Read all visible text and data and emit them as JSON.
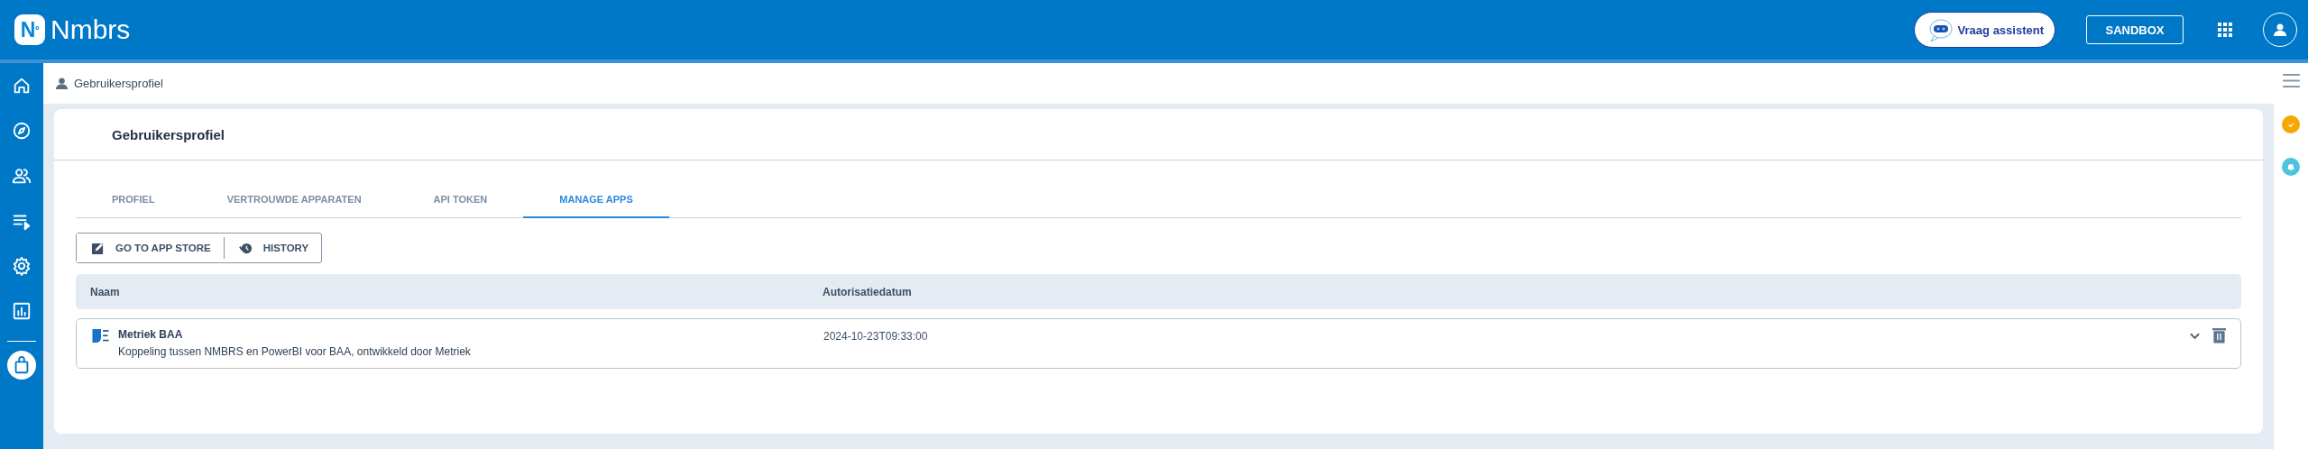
{
  "header": {
    "logo_mark": "N",
    "logo_sup": "º",
    "brand": "Nmbrs",
    "assistant": "Vraag assistent",
    "environment": "SANDBOX"
  },
  "sidebar": {
    "items": [
      {
        "kind": "home",
        "selected": false
      },
      {
        "kind": "compass",
        "selected": false
      },
      {
        "kind": "people",
        "selected": false
      },
      {
        "kind": "queue",
        "selected": false
      },
      {
        "kind": "settings",
        "selected": false
      },
      {
        "kind": "chart",
        "selected": false
      },
      {
        "kind": "bag",
        "selected": true
      }
    ]
  },
  "breadcrumb": "Gebruikersprofiel",
  "card": {
    "title": "Gebruikersprofiel",
    "tabs": [
      {
        "label": "PROFIEL",
        "selected": false
      },
      {
        "label": "VERTROUWDE APPARATEN",
        "selected": false
      },
      {
        "label": "API TOKEN",
        "selected": false
      },
      {
        "label": "MANAGE APPS",
        "selected": true
      }
    ],
    "actions": [
      {
        "kind": "store",
        "label": "GO TO APP STORE"
      },
      {
        "kind": "history",
        "label": "HISTORY"
      }
    ],
    "table": {
      "columns": [
        "Naam",
        "Autorisatiedatum"
      ],
      "rows": [
        {
          "name": "Metriek BAA",
          "description": "Koppeling tussen NMBRS en PowerBI voor BAA, ontwikkeld door Metriek",
          "date": "2024-10-23T09:33:00",
          "expanded": false
        }
      ]
    }
  },
  "right_rail": {
    "badges": [
      {
        "kind": "check",
        "color": "#f5a800"
      },
      {
        "kind": "bell",
        "color": "#4ec3e0"
      }
    ]
  }
}
